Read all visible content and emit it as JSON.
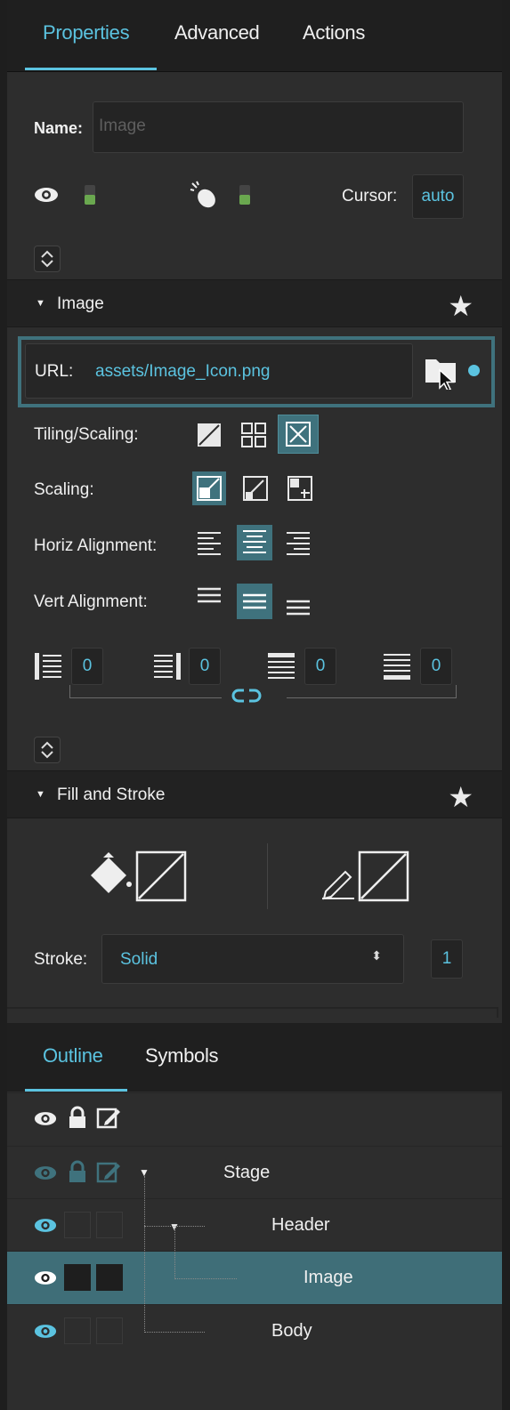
{
  "tabs": [
    {
      "label": "Properties"
    },
    {
      "label": "Advanced"
    },
    {
      "label": "Actions"
    }
  ],
  "name": {
    "label": "Name:",
    "placeholder": "Image"
  },
  "cursor": {
    "label": "Cursor:",
    "value": "auto"
  },
  "image_section": {
    "title": "Image",
    "url_label": "URL:",
    "url_value": "assets/Image_Icon.png",
    "tiling_label": "Tiling/Scaling:",
    "scaling_label": "Scaling:",
    "horiz_label": "Horiz Alignment:",
    "vert_label": "Vert Alignment:",
    "padding": [
      "0",
      "0",
      "0",
      "0"
    ]
  },
  "fill_section": {
    "title": "Fill and Stroke",
    "stroke_label": "Stroke:",
    "stroke_value": "Solid",
    "stroke_width": "1"
  },
  "outline_tabs": [
    {
      "label": "Outline"
    },
    {
      "label": "Symbols"
    }
  ],
  "outline_rows": [
    {
      "label": "Stage"
    },
    {
      "label": "Header"
    },
    {
      "label": "Image"
    },
    {
      "label": "Body"
    }
  ],
  "colors": {
    "accent": "#5bc3e0",
    "highlight": "#3f727d",
    "selected_row": "#3f6e78",
    "toggle_green": "#6aa84f"
  }
}
